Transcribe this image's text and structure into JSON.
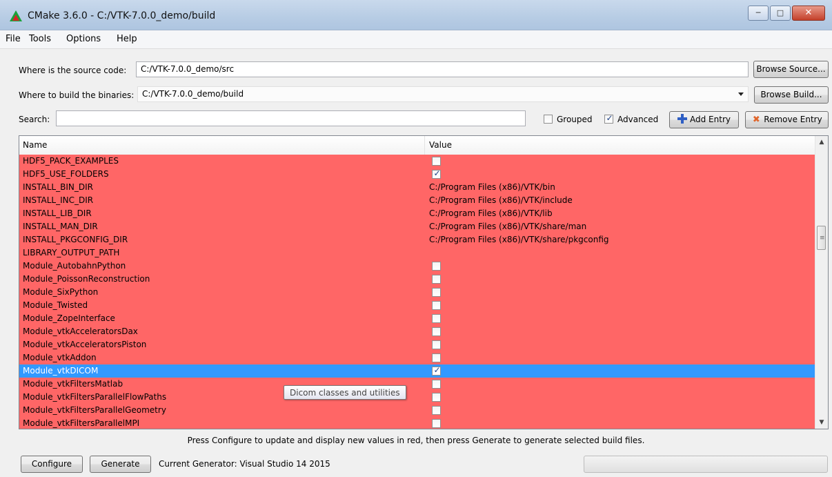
{
  "window": {
    "title": "CMake 3.6.0 - C:/VTK-7.0.0_demo/build"
  },
  "menu": [
    "File",
    "Tools",
    "Options",
    "Help"
  ],
  "source": {
    "label": "Where is the source code:",
    "value": "C:/VTK-7.0.0_demo/src",
    "button": "Browse Source..."
  },
  "build": {
    "label": "Where to build the binaries:",
    "value": "C:/VTK-7.0.0_demo/build",
    "button": "Browse Build..."
  },
  "search": {
    "label": "Search:",
    "value": ""
  },
  "options": {
    "grouped_label": "Grouped",
    "grouped_checked": false,
    "advanced_label": "Advanced",
    "advanced_checked": true,
    "add_entry": "Add Entry",
    "remove_entry": "Remove Entry"
  },
  "table": {
    "col_name": "Name",
    "col_value": "Value",
    "rows": [
      {
        "name": "HDF5_PACK_EXAMPLES",
        "type": "bool",
        "checked": false
      },
      {
        "name": "HDF5_USE_FOLDERS",
        "type": "bool",
        "checked": true
      },
      {
        "name": "INSTALL_BIN_DIR",
        "type": "text",
        "value": "C:/Program Files (x86)/VTK/bin"
      },
      {
        "name": "INSTALL_INC_DIR",
        "type": "text",
        "value": "C:/Program Files (x86)/VTK/include"
      },
      {
        "name": "INSTALL_LIB_DIR",
        "type": "text",
        "value": "C:/Program Files (x86)/VTK/lib"
      },
      {
        "name": "INSTALL_MAN_DIR",
        "type": "text",
        "value": "C:/Program Files (x86)/VTK/share/man"
      },
      {
        "name": "INSTALL_PKGCONFIG_DIR",
        "type": "text",
        "value": "C:/Program Files (x86)/VTK/share/pkgconfig"
      },
      {
        "name": "LIBRARY_OUTPUT_PATH",
        "type": "text",
        "value": ""
      },
      {
        "name": "Module_AutobahnPython",
        "type": "bool",
        "checked": false
      },
      {
        "name": "Module_PoissonReconstruction",
        "type": "bool",
        "checked": false
      },
      {
        "name": "Module_SixPython",
        "type": "bool",
        "checked": false
      },
      {
        "name": "Module_Twisted",
        "type": "bool",
        "checked": false
      },
      {
        "name": "Module_ZopeInterface",
        "type": "bool",
        "checked": false
      },
      {
        "name": "Module_vtkAcceleratorsDax",
        "type": "bool",
        "checked": false
      },
      {
        "name": "Module_vtkAcceleratorsPiston",
        "type": "bool",
        "checked": false
      },
      {
        "name": "Module_vtkAddon",
        "type": "bool",
        "checked": false
      },
      {
        "name": "Module_vtkDICOM",
        "type": "bool",
        "checked": true,
        "selected": true
      },
      {
        "name": "Module_vtkFiltersMatlab",
        "type": "bool",
        "checked": false
      },
      {
        "name": "Module_vtkFiltersParallelFlowPaths",
        "type": "bool",
        "checked": false
      },
      {
        "name": "Module_vtkFiltersParallelGeometry",
        "type": "bool",
        "checked": false
      },
      {
        "name": "Module_vtkFiltersParallelMPI",
        "type": "bool",
        "checked": false
      }
    ]
  },
  "tooltip": "Dicom classes and utilities",
  "hint": "Press Configure to update and display new values in red, then press Generate to generate selected build files.",
  "bottom": {
    "configure": "Configure",
    "generate": "Generate",
    "generator": "Current Generator: Visual Studio 14 2015",
    "progress": 0
  },
  "colors": {
    "new_value_row": "#ff6666",
    "selected_row": "#3399ff"
  }
}
